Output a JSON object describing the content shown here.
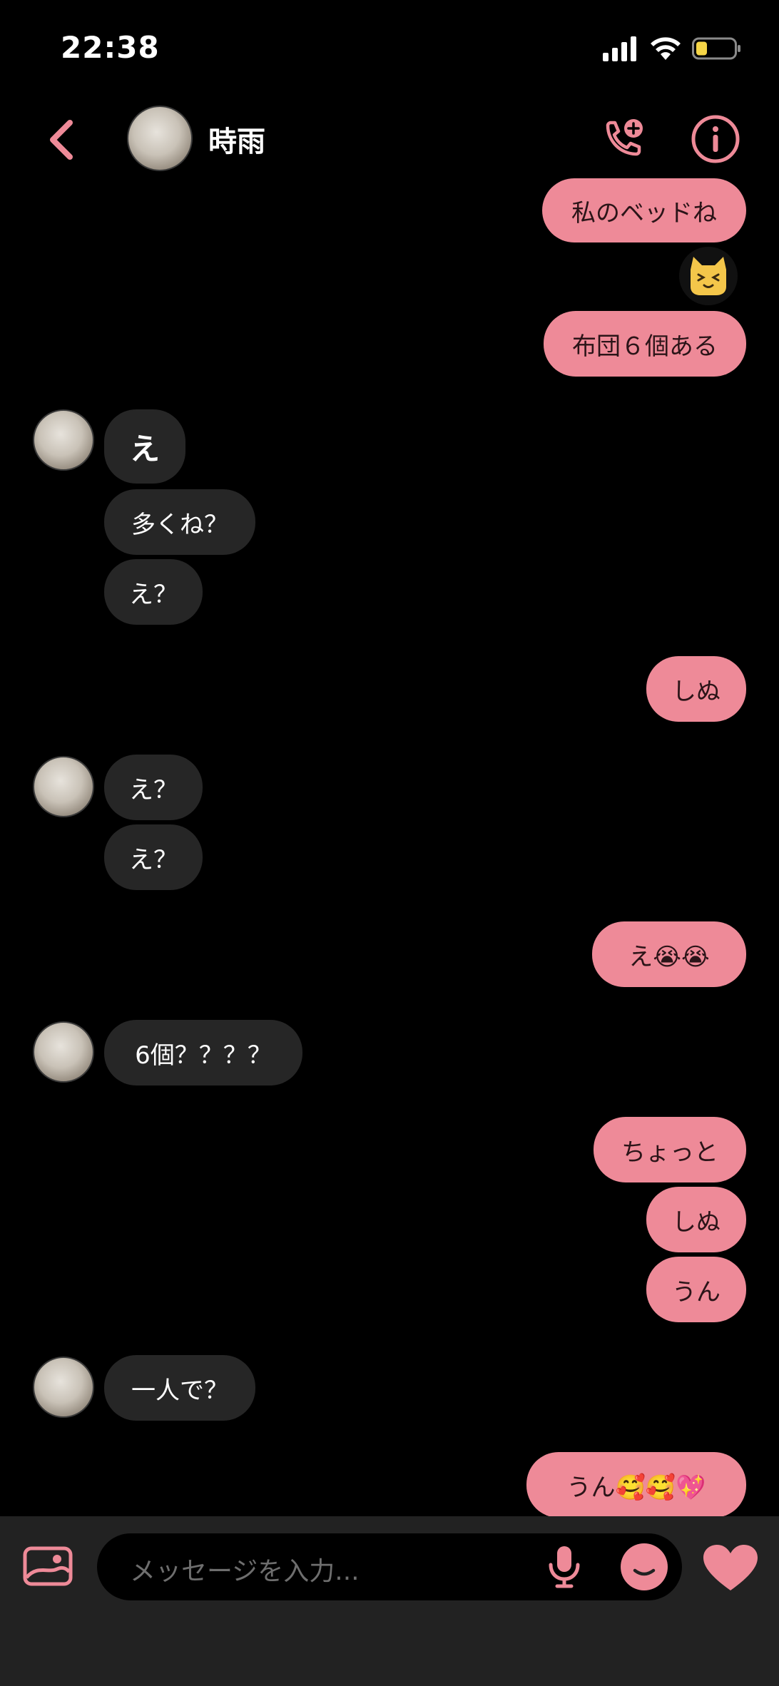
{
  "status_bar": {
    "time": "22:38"
  },
  "header": {
    "name": "時雨"
  },
  "accent_color": "#ee8a98",
  "messages": {
    "m1": "私のベッドね",
    "sticker": "cat-sticker",
    "m2": "布団６個ある",
    "m3": "え",
    "m4": "多くね？",
    "m5": "え？",
    "m6": "しぬ",
    "m7": "え？",
    "m8": "え？",
    "m9": "え😭😭",
    "m10": "6個？？？？",
    "m11": "ちょっと",
    "m12": "しぬ",
    "m13": "うん",
    "m14": "一人で？",
    "m15": "うん🥰🥰💖"
  },
  "composer": {
    "placeholder": "メッセージを入力..."
  }
}
